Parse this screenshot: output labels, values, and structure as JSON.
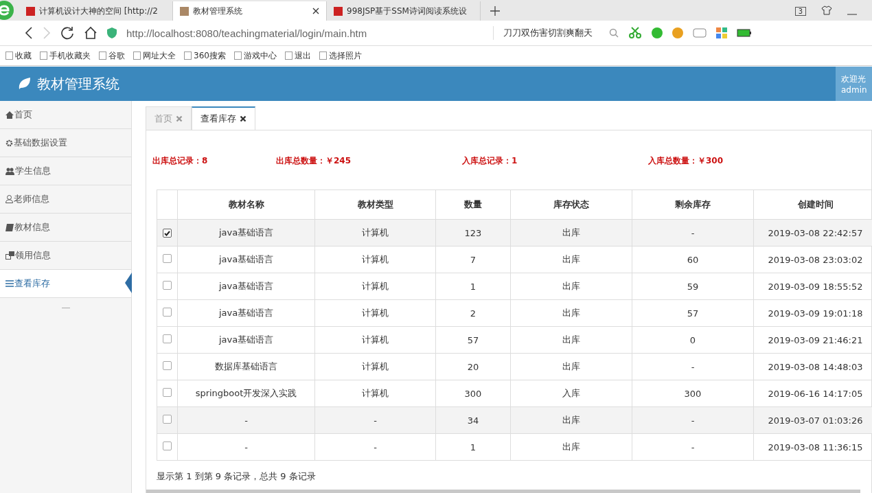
{
  "browser": {
    "tabs": [
      {
        "title": "计算机设计大神的空间 [http://2",
        "selected": false
      },
      {
        "title": "教材管理系统",
        "selected": true
      },
      {
        "title": "998JSP基于SSM诗词阅读系统设",
        "selected": false
      }
    ],
    "tab_count": "3",
    "address": "http://localhost:8080/teachingmaterial/login/main.htm",
    "search_text": "刀刀双伤害切割爽翻天",
    "bookmarks": [
      "收藏",
      "手机收藏夹",
      "谷歌",
      "网址大全",
      "360搜索",
      "游戏中心",
      "退出",
      "选择照片"
    ]
  },
  "header": {
    "title": "教材管理系统",
    "welcome": "欢迎光",
    "user": "admin"
  },
  "sidebar": {
    "items": [
      {
        "kind": "home",
        "label": "首页",
        "selected": false
      },
      {
        "kind": "gear",
        "label": "基础数据设置",
        "selected": false
      },
      {
        "kind": "users",
        "label": "学生信息",
        "selected": false
      },
      {
        "kind": "user",
        "label": "老师信息",
        "selected": false
      },
      {
        "kind": "book",
        "label": "教材信息",
        "selected": false
      },
      {
        "kind": "windows",
        "label": "领用信息",
        "selected": false
      },
      {
        "kind": "list",
        "label": "查看库存",
        "selected": true
      }
    ]
  },
  "content_tabs": [
    {
      "label": "首页",
      "selected": false
    },
    {
      "label": "查看库存",
      "selected": true
    }
  ],
  "summary": [
    "出库总记录：8",
    "出库总数量：￥245",
    "入库总记录：1",
    "入库总数量：￥300"
  ],
  "table": {
    "columns": [
      "教材名称",
      "教材类型",
      "数量",
      "库存状态",
      "剩余库存",
      "创建时间"
    ],
    "rows": [
      {
        "checked": true,
        "highlighted": true,
        "cells": [
          "java基础语言",
          "计算机",
          "123",
          "出库",
          "-",
          "2019-03-08 22:42:57"
        ]
      },
      {
        "checked": false,
        "highlighted": false,
        "cells": [
          "java基础语言",
          "计算机",
          "7",
          "出库",
          "60",
          "2019-03-08 23:03:02"
        ]
      },
      {
        "checked": false,
        "highlighted": false,
        "cells": [
          "java基础语言",
          "计算机",
          "1",
          "出库",
          "59",
          "2019-03-09 18:55:52"
        ]
      },
      {
        "checked": false,
        "highlighted": false,
        "cells": [
          "java基础语言",
          "计算机",
          "2",
          "出库",
          "57",
          "2019-03-09 19:01:18"
        ]
      },
      {
        "checked": false,
        "highlighted": false,
        "cells": [
          "java基础语言",
          "计算机",
          "57",
          "出库",
          "0",
          "2019-03-09 21:46:21"
        ]
      },
      {
        "checked": false,
        "highlighted": false,
        "cells": [
          "数据库基础语言",
          "计算机",
          "20",
          "出库",
          "-",
          "2019-03-08 14:48:03"
        ]
      },
      {
        "checked": false,
        "highlighted": false,
        "cells": [
          "springboot开发深入实践",
          "计算机",
          "300",
          "入库",
          "300",
          "2019-06-16 14:17:05"
        ]
      },
      {
        "checked": false,
        "highlighted": true,
        "cells": [
          "-",
          "-",
          "34",
          "出库",
          "-",
          "2019-03-07 01:03:26"
        ]
      },
      {
        "checked": false,
        "highlighted": false,
        "cells": [
          "-",
          "-",
          "1",
          "出库",
          "-",
          "2019-03-08 11:36:15"
        ]
      }
    ]
  },
  "pagination": "显示第 1 到第 9 条记录，总共 9 条记录"
}
